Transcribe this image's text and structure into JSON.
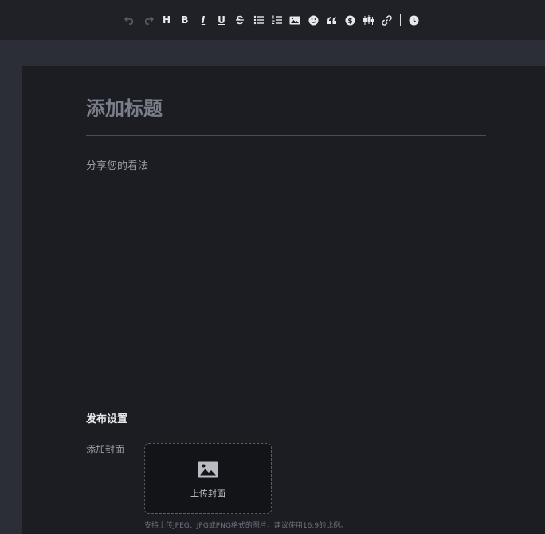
{
  "toolbar": {
    "buttons": [
      {
        "name": "undo-icon",
        "glyph": "undo",
        "enabled": false
      },
      {
        "name": "redo-icon",
        "glyph": "redo",
        "enabled": false
      },
      {
        "name": "heading-button",
        "glyph": "H"
      },
      {
        "name": "bold-button",
        "glyph": "B"
      },
      {
        "name": "italic-button",
        "glyph": "I"
      },
      {
        "name": "underline-button",
        "glyph": "U"
      },
      {
        "name": "strikethrough-button",
        "glyph": "S"
      },
      {
        "name": "bullet-list-icon",
        "glyph": "bullet-list"
      },
      {
        "name": "numbered-list-icon",
        "glyph": "numbered-list"
      },
      {
        "name": "image-icon",
        "glyph": "image"
      },
      {
        "name": "emoji-icon",
        "glyph": "smile"
      },
      {
        "name": "quote-icon",
        "glyph": "quote"
      },
      {
        "name": "dollar-icon",
        "glyph": "dollar"
      },
      {
        "name": "candlestick-icon",
        "glyph": "candlestick"
      },
      {
        "name": "link-icon",
        "glyph": "link"
      },
      {
        "name": "clock-icon",
        "glyph": "clock"
      }
    ],
    "heading_label": "H",
    "bold_label": "B",
    "italic_label": "I",
    "underline_label": "U"
  },
  "editor": {
    "title_placeholder": "添加标题",
    "body_placeholder": "分享您的看法"
  },
  "publish_settings": {
    "section_title": "发布设置",
    "cover_label": "添加封面",
    "upload_label": "上传封面",
    "upload_hint": "支持上传JPEG、JPG或PNG格式的图片，建议使用16:9的比例。"
  },
  "colors": {
    "toolbar_bg": "#1f2126",
    "page_bg": "#2b2e36",
    "editor_bg": "#1b1d23",
    "text_primary": "#e6e7ea",
    "text_muted": "#9a9ea8"
  }
}
